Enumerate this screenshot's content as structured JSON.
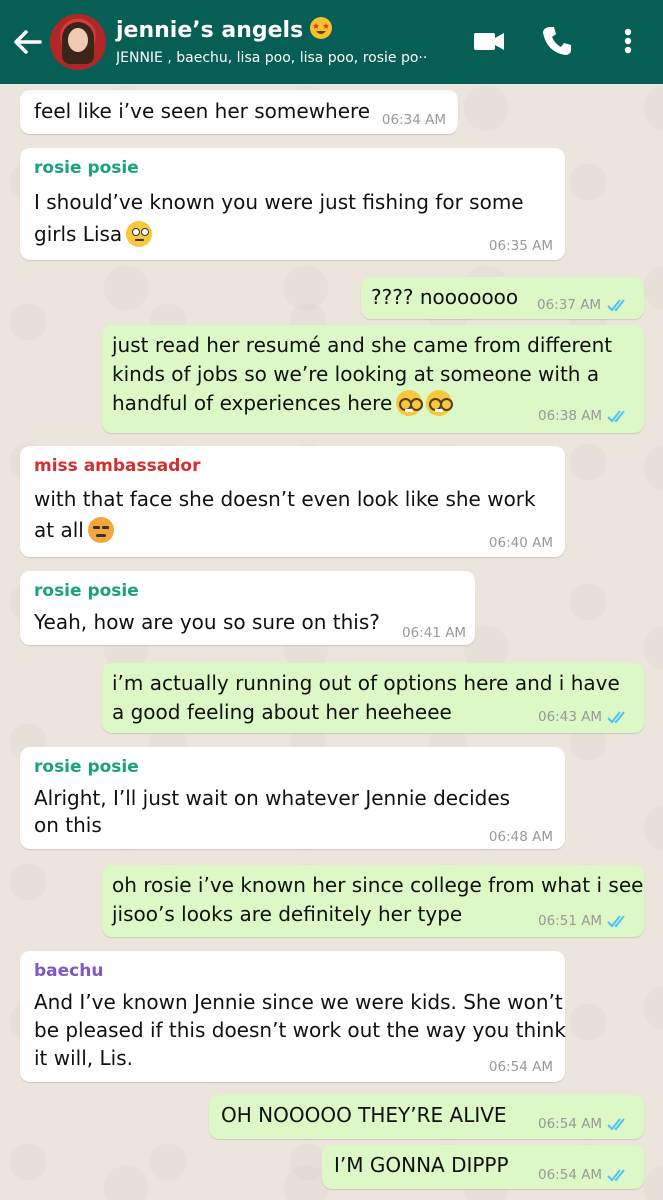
{
  "header": {
    "title": "jennie’s angels",
    "title_emoji": "star-struck-emoji",
    "subtitle": "JENNIE , baechu, lisa poo, lisa poo, rosie po··",
    "icons": [
      "back-arrow-icon",
      "video-call-icon",
      "phone-icon",
      "more-options-icon"
    ],
    "bg_color": "#075e54"
  },
  "colors": {
    "incoming": "#ffffff",
    "outgoing": "#dcf8c6",
    "chat_bg": "#ece5dd",
    "rosie": "#1aa37a",
    "ambassador": "#d32f2f",
    "baechu": "#7e57c2",
    "read_ticks": "#4fc3f7"
  },
  "messages": [
    {
      "dir": "in",
      "sender": "",
      "lines": [
        "feel like i’ve seen her somewhere"
      ],
      "time": "06:34 AM"
    },
    {
      "dir": "in",
      "sender": "rosie posie",
      "lines": [
        "I should’ve known you were just fishing for some",
        "girls Lisa"
      ],
      "emoji": "eye-roll-emoji",
      "time": "06:35 AM"
    },
    {
      "dir": "out",
      "sender": "",
      "lines": [
        "???? nooooooo"
      ],
      "time": "06:37 AM"
    },
    {
      "dir": "out",
      "sender": "",
      "lines": [
        "just read her resumé and she came from different",
        "kinds of jobs so we’re looking at someone with a",
        "handful of experiences here"
      ],
      "emoji": "nerd-face-emoji x2",
      "time": "06:38 AM"
    },
    {
      "dir": "in",
      "sender": "miss ambassador",
      "lines": [
        "with that face she doesn’t even look like she work",
        "at all"
      ],
      "emoji": "confounded-face-emoji",
      "time": "06:40 AM"
    },
    {
      "dir": "in",
      "sender": "rosie posie",
      "lines": [
        "Yeah, how are you so sure on this?"
      ],
      "time": "06:41 AM"
    },
    {
      "dir": "out",
      "sender": "",
      "lines": [
        "i’m actually running out of options here and i have",
        "a good feeling about her heeheee"
      ],
      "time": "06:43 AM"
    },
    {
      "dir": "in",
      "sender": "rosie posie",
      "lines": [
        "Alright, I’ll just wait on whatever Jennie decides",
        "on this"
      ],
      "time": "06:48 AM"
    },
    {
      "dir": "out",
      "sender": "",
      "lines": [
        "oh rosie i’ve known her since college from what i see",
        "jisoo’s looks are definitely her type"
      ],
      "time": "06:51 AM"
    },
    {
      "dir": "in",
      "sender": "baechu",
      "lines": [
        "And I’ve known Jennie since we were kids. She won’t",
        "be pleased if this doesn’t work out the way you think",
        "it will, Lis."
      ],
      "time": "06:54 AM"
    },
    {
      "dir": "out",
      "sender": "",
      "lines": [
        "OH NOOOOO THEY’RE ALIVE"
      ],
      "time": "06:54 AM"
    },
    {
      "dir": "out",
      "sender": "",
      "lines": [
        "I’M GONNA DIPPP"
      ],
      "time": "06:54 AM"
    }
  ]
}
